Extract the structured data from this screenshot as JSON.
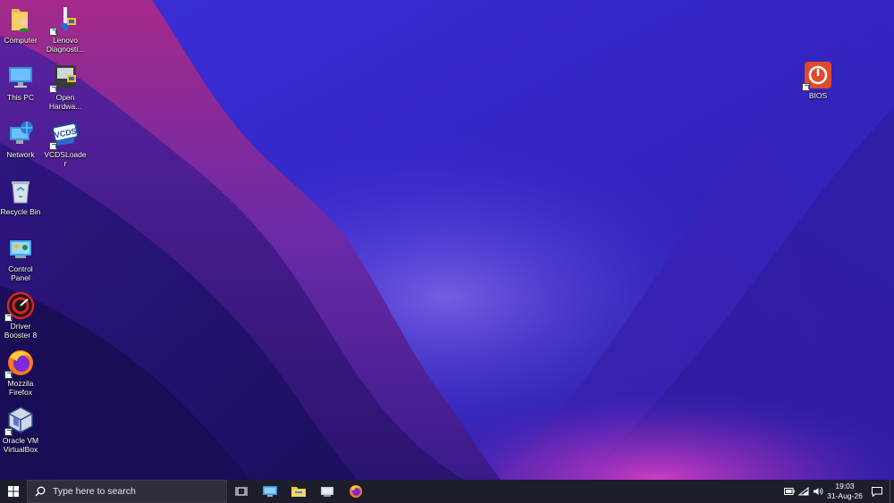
{
  "desktop": {
    "icons": [
      {
        "label": "Computer"
      },
      {
        "label": "Lenovo Diagnosti..."
      },
      {
        "label": "This PC"
      },
      {
        "label": "Open Hardwa..."
      },
      {
        "label": "Network"
      },
      {
        "label": "VCDSLoader"
      },
      {
        "label": "Recycle Bin"
      },
      {
        "label": "Control Panel"
      },
      {
        "label": "Driver Booster 8"
      },
      {
        "label": "Mozzila Firefox"
      },
      {
        "label": "Oracle VM VirtualBox"
      },
      {
        "label": "BIOS"
      }
    ],
    "vcds_badge": "VCDS"
  },
  "taskbar": {
    "search_placeholder": "Type here to search",
    "pinned": [
      "task-view",
      "remote-desktop",
      "file-explorer",
      "devices",
      "firefox"
    ],
    "clock": {
      "time": "19:03",
      "date": "31-Aug-26"
    }
  },
  "colors": {
    "taskbar": "#1c1e2b",
    "wallpaper_dark": "#1b0f5e",
    "wallpaper_mid": "#3a2bd0",
    "wallpaper_glow": "#c236c8"
  }
}
